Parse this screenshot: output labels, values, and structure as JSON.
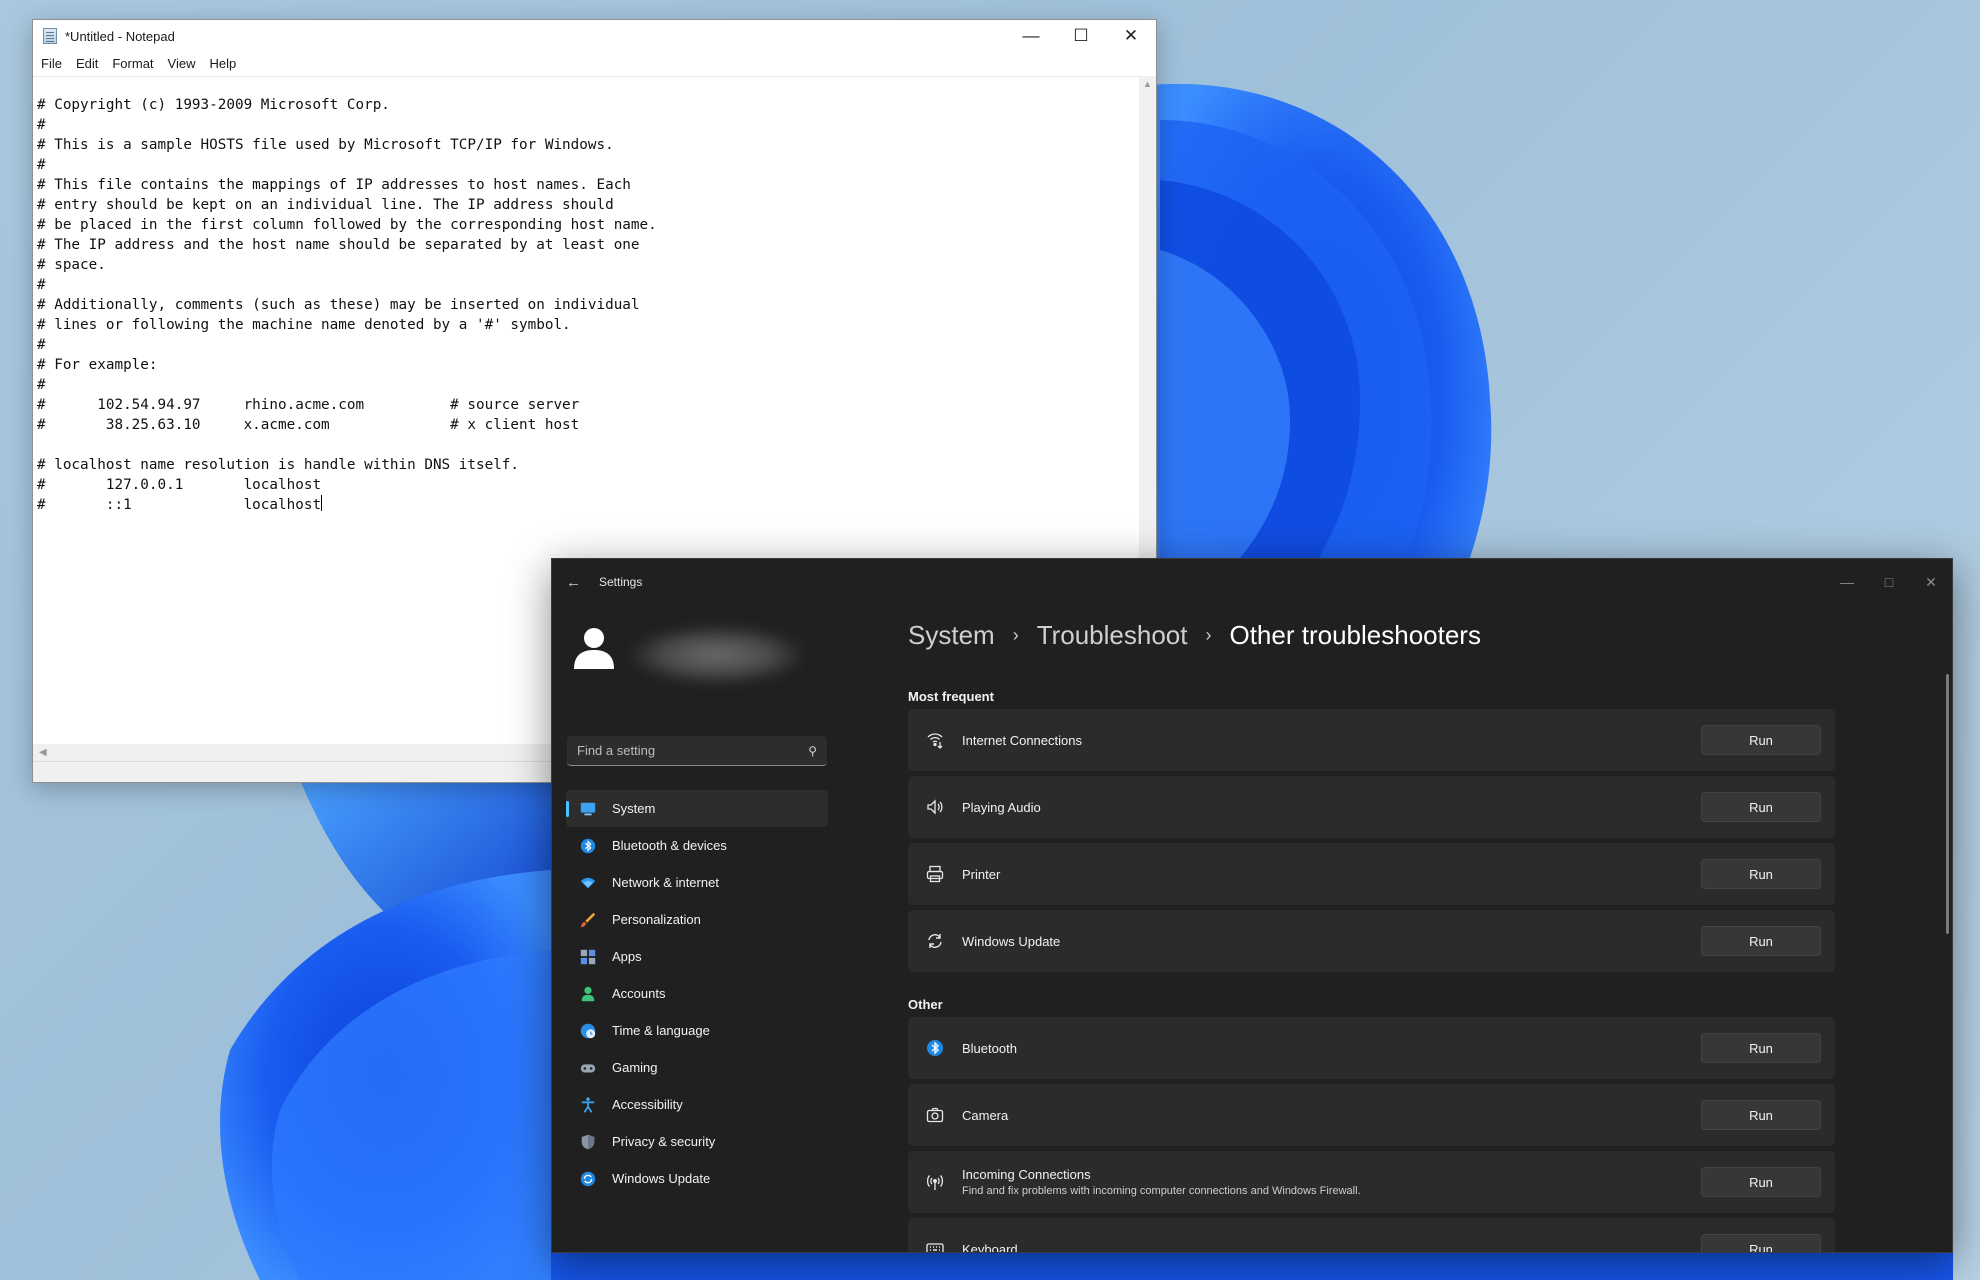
{
  "notepad": {
    "title": "*Untitled - Notepad",
    "menu": [
      "File",
      "Edit",
      "Format",
      "View",
      "Help"
    ],
    "lines": [
      "# Copyright (c) 1993-2009 Microsoft Corp.",
      "#",
      "# This is a sample HOSTS file used by Microsoft TCP/IP for Windows.",
      "#",
      "# This file contains the mappings of IP addresses to host names. Each",
      "# entry should be kept on an individual line. The IP address should",
      "# be placed in the first column followed by the corresponding host name.",
      "# The IP address and the host name should be separated by at least one",
      "# space.",
      "#",
      "# Additionally, comments (such as these) may be inserted on individual",
      "# lines or following the machine name denoted by a '#' symbol.",
      "#",
      "# For example:",
      "#",
      "#      102.54.94.97     rhino.acme.com          # source server",
      "#       38.25.63.10     x.acme.com              # x client host",
      "",
      "# localhost name resolution is handle within DNS itself.",
      "#       127.0.0.1       localhost",
      "#       ::1             localhost"
    ]
  },
  "settings": {
    "title": "Settings",
    "search_placeholder": "Find a setting",
    "nav": [
      {
        "label": "System",
        "icon": "system-icon",
        "active": true
      },
      {
        "label": "Bluetooth & devices",
        "icon": "bluetooth-icon"
      },
      {
        "label": "Network & internet",
        "icon": "wifi-icon"
      },
      {
        "label": "Personalization",
        "icon": "brush-icon"
      },
      {
        "label": "Apps",
        "icon": "apps-icon"
      },
      {
        "label": "Accounts",
        "icon": "person-icon"
      },
      {
        "label": "Time & language",
        "icon": "globe-clock-icon"
      },
      {
        "label": "Gaming",
        "icon": "gamepad-icon"
      },
      {
        "label": "Accessibility",
        "icon": "accessibility-icon"
      },
      {
        "label": "Privacy & security",
        "icon": "shield-icon"
      },
      {
        "label": "Windows Update",
        "icon": "update-icon"
      }
    ],
    "breadcrumb": [
      "System",
      "Troubleshoot",
      "Other troubleshooters"
    ],
    "sections": [
      {
        "label": "Most frequent",
        "items": [
          {
            "title": "Internet Connections",
            "icon": "internet-icon",
            "button": "Run"
          },
          {
            "title": "Playing Audio",
            "icon": "speaker-icon",
            "button": "Run"
          },
          {
            "title": "Printer",
            "icon": "printer-icon",
            "button": "Run"
          },
          {
            "title": "Windows Update",
            "icon": "refresh-icon",
            "button": "Run"
          }
        ]
      },
      {
        "label": "Other",
        "items": [
          {
            "title": "Bluetooth",
            "icon": "bluetooth-icon",
            "button": "Run"
          },
          {
            "title": "Camera",
            "icon": "camera-icon",
            "button": "Run"
          },
          {
            "title": "Incoming Connections",
            "desc": "Find and fix problems with incoming computer connections and Windows Firewall.",
            "icon": "antenna-icon",
            "button": "Run"
          },
          {
            "title": "Keyboard",
            "icon": "keyboard-icon",
            "button": "Run"
          }
        ]
      }
    ],
    "colors": {
      "accent": "#4cc2ff",
      "background": "#202020",
      "card": "#2b2b2b"
    }
  }
}
